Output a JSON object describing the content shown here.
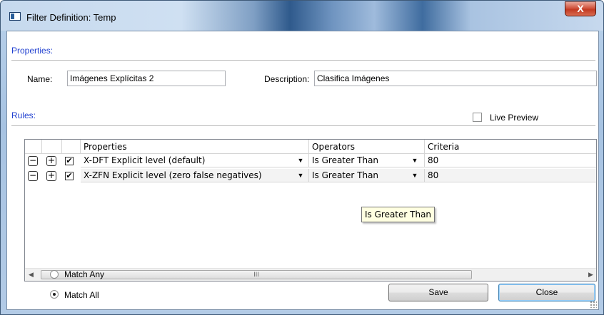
{
  "window": {
    "title": "Filter Definition: Temp",
    "close_glyph": "X",
    "icon": "window-app-icon"
  },
  "properties_section": {
    "label": "Properties:",
    "name_label": "Name:",
    "name_value": "Imágenes Explícitas 2",
    "description_label": "Description:",
    "description_value": "Clasifica Imágenes"
  },
  "rules_section": {
    "label": "Rules:",
    "live_preview_label": "Live Preview",
    "live_preview_checked": false
  },
  "grid": {
    "columns": [
      "Properties",
      "Operators",
      "Criteria"
    ],
    "rows": [
      {
        "remove": "−",
        "add": "+",
        "checked": "✔",
        "property": "X-DFT Explicit level (default)",
        "operator": "Is Greater Than",
        "criteria": "80"
      },
      {
        "remove": "−",
        "add": "+",
        "checked": "✔",
        "property": "X-ZFN Explicit level (zero false negatives)",
        "operator": "Is Greater Than",
        "criteria": "80"
      }
    ],
    "tooltip": "Is Greater Than",
    "scrollbar_grip": "III"
  },
  "match": {
    "any_label": "Match Any",
    "all_label": "Match All",
    "selected": "Match All"
  },
  "buttons": {
    "save": "Save",
    "close": "Close"
  }
}
